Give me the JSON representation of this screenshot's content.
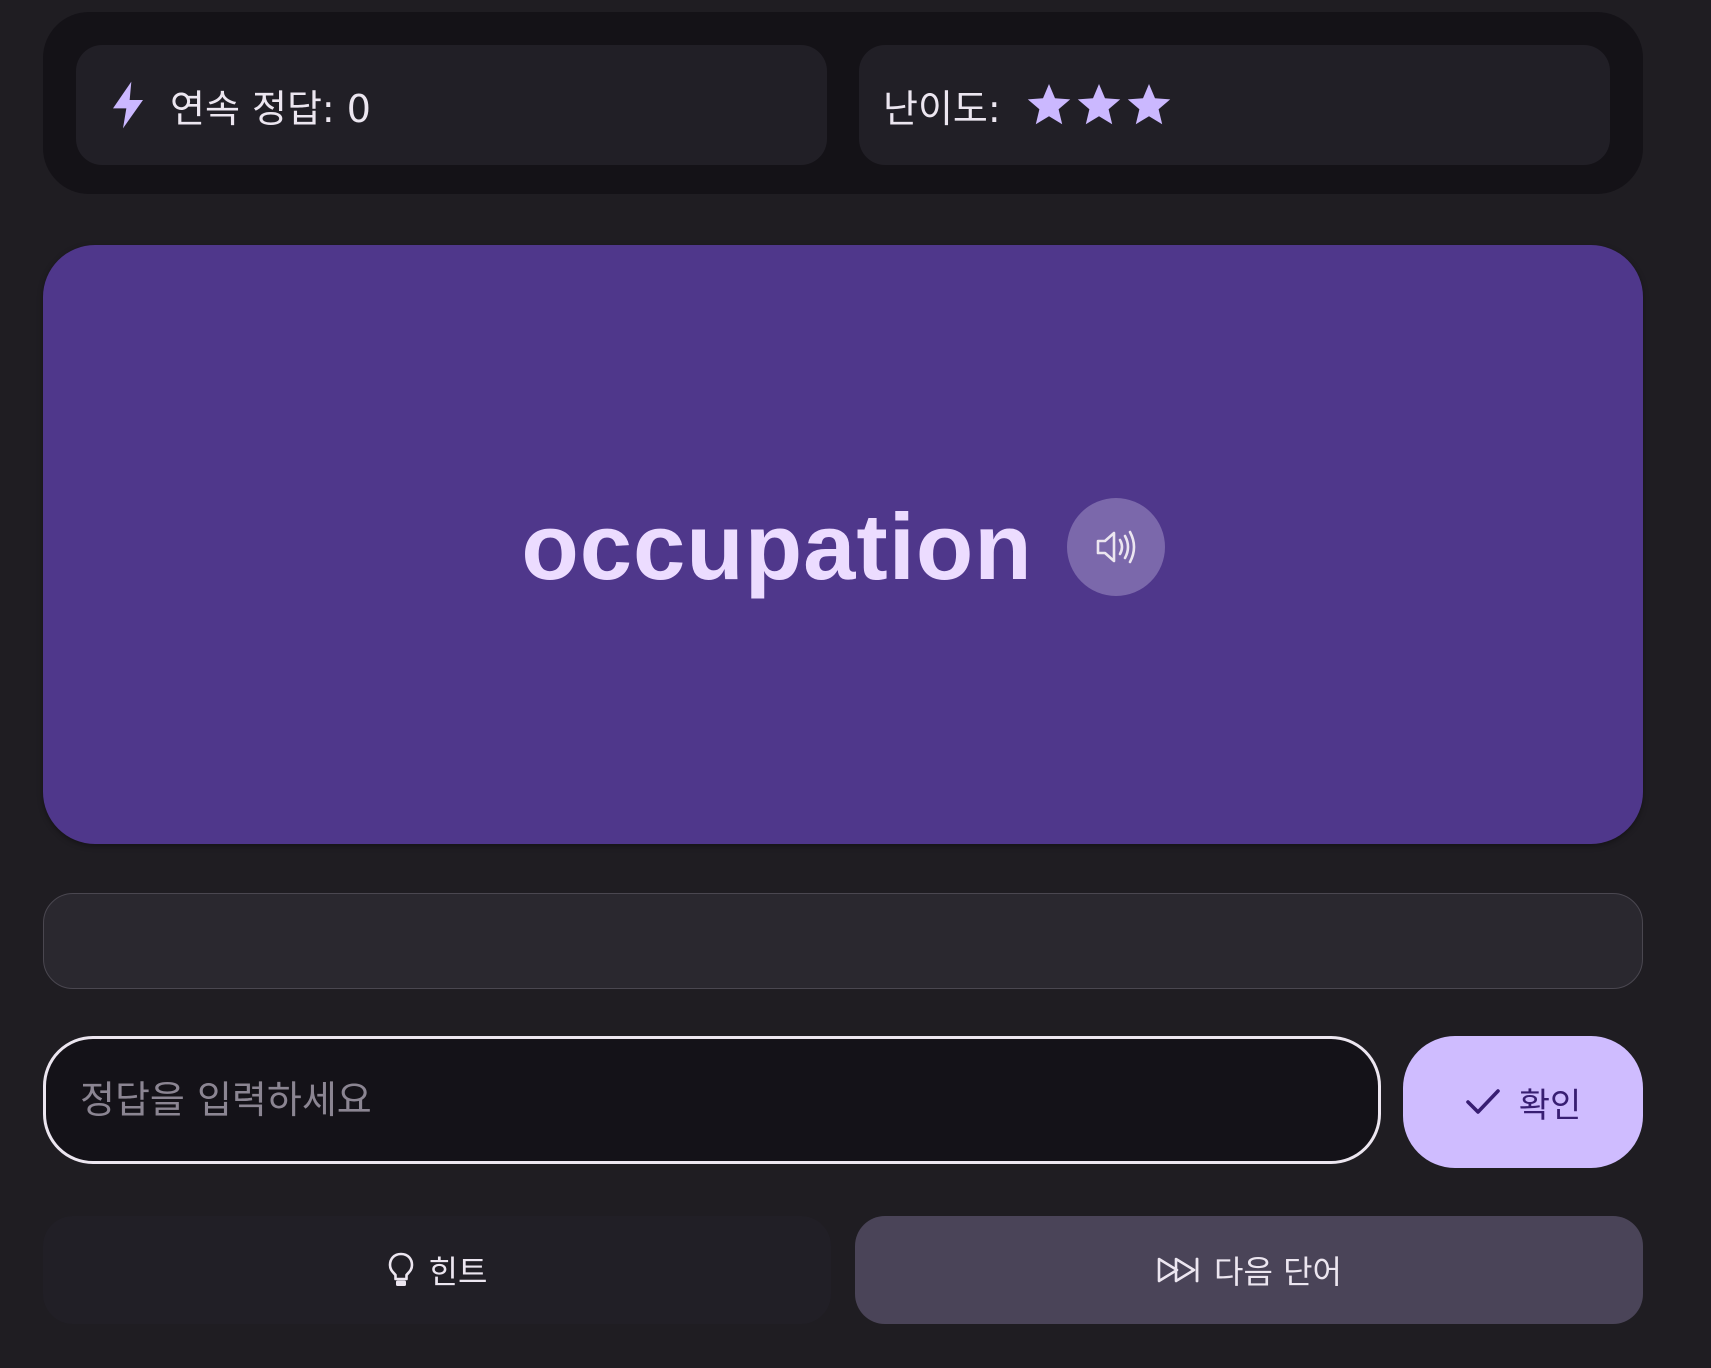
{
  "stats": {
    "streak_label": "연속 정답: 0",
    "difficulty_label": "난이도:",
    "difficulty_stars": 3,
    "difficulty_max": 3
  },
  "word_card": {
    "word": "occupation"
  },
  "answer": {
    "placeholder": "정답을 입력하세요",
    "value": ""
  },
  "buttons": {
    "confirm_label": "확인",
    "hint_label": "힌트",
    "next_label": "다음 단어"
  },
  "colors": {
    "accent": "#cfbcff",
    "card": "#4f378b",
    "background": "#1f1d22"
  }
}
